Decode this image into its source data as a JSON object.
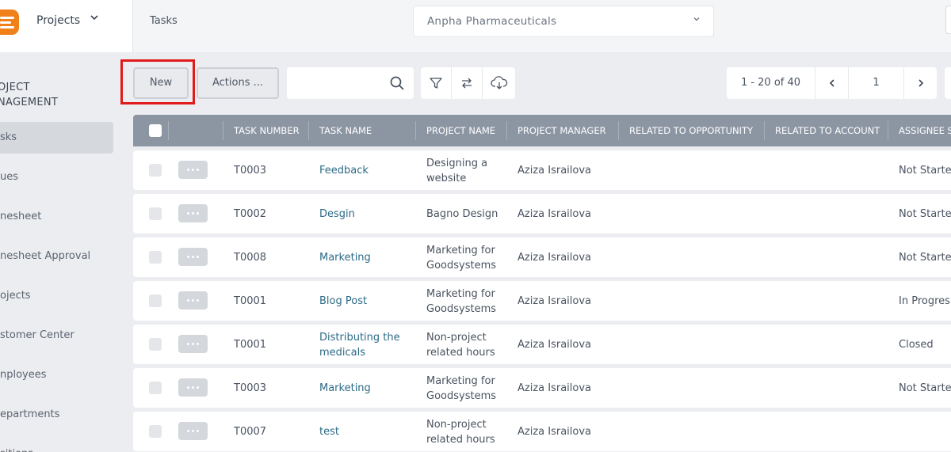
{
  "app": {
    "module_label": "Projects",
    "breadcrumb": "Tasks",
    "company": "Anpha Pharmaceuticals"
  },
  "sidebar": {
    "section": [
      "OJECT",
      "NAGEMENT"
    ],
    "items": [
      {
        "label": "sks",
        "active": true
      },
      {
        "label": "ues",
        "active": false
      },
      {
        "label": "nesheet",
        "active": false
      },
      {
        "label": "nesheet Approval",
        "active": false
      },
      {
        "label": "ojects",
        "active": false
      },
      {
        "label": "stomer Center",
        "active": false
      },
      {
        "label": "nployees",
        "active": false
      },
      {
        "label": "epartments",
        "active": false
      },
      {
        "label": "sitions",
        "active": false
      }
    ]
  },
  "toolbar": {
    "new_label": "New",
    "actions_label": "Actions ...",
    "search_value": "",
    "icons": [
      "search-icon",
      "filter-icon",
      "swap-icon",
      "cloud-download-icon"
    ]
  },
  "pager": {
    "range": "1 - 20 of 40",
    "page": "1"
  },
  "table": {
    "columns": [
      "TASK NUMBER",
      "TASK NAME",
      "PROJECT NAME",
      "PROJECT MANAGER",
      "RELATED TO OPPORTUNITY",
      "RELATED TO ACCOUNT",
      "ASSIGNEE S"
    ],
    "rows": [
      {
        "task_number": "T0003",
        "task_name": [
          "Feedback"
        ],
        "project_name": [
          "Designing a",
          "website"
        ],
        "manager": "Aziza Israilova",
        "opportunity": "",
        "account": "",
        "status": "Not Starte"
      },
      {
        "task_number": "T0002",
        "task_name": [
          "Desgin"
        ],
        "project_name": [
          "Bagno Design"
        ],
        "manager": "Aziza Israilova",
        "opportunity": "",
        "account": "",
        "status": "Not Starte"
      },
      {
        "task_number": "T0008",
        "task_name": [
          "Marketing"
        ],
        "project_name": [
          "Marketing for",
          "Goodsystems"
        ],
        "manager": "Aziza Israilova",
        "opportunity": "",
        "account": "",
        "status": "Not Starte"
      },
      {
        "task_number": "T0001",
        "task_name": [
          "Blog Post"
        ],
        "project_name": [
          "Marketing for",
          "Goodsystems"
        ],
        "manager": "Aziza Israilova",
        "opportunity": "",
        "account": "",
        "status": "In Progres"
      },
      {
        "task_number": "T0001",
        "task_name": [
          "Distributing the",
          "medicals"
        ],
        "project_name": [
          "Non-project",
          "related hours"
        ],
        "manager": "Aziza Israilova",
        "opportunity": "",
        "account": "",
        "status": "Closed"
      },
      {
        "task_number": "T0003",
        "task_name": [
          "Marketing"
        ],
        "project_name": [
          "Marketing for",
          "Goodsystems"
        ],
        "manager": "Aziza Israilova",
        "opportunity": "",
        "account": "",
        "status": "Not Starte"
      },
      {
        "task_number": "T0007",
        "task_name": [
          "test"
        ],
        "project_name": [
          "Non-project",
          "related hours"
        ],
        "manager": "Aziza Israilova",
        "opportunity": "",
        "account": "",
        "status": ""
      }
    ]
  },
  "colors": {
    "accent_orange": "#f0801a",
    "header_gray": "#8c96a3",
    "link_teal": "#2c6a86",
    "highlight_red": "#e01b1b"
  }
}
